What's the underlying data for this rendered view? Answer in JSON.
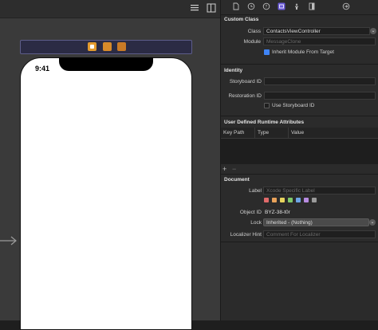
{
  "canvas": {
    "device_time": "9:41",
    "top_icons": [
      "list-icon",
      "split-view-icon"
    ],
    "scene_icons": [
      "view-controller-icon",
      "first-responder-icon",
      "exit-icon"
    ]
  },
  "inspector": {
    "tab_icons": [
      "file-icon",
      "history-icon",
      "help-icon",
      "identity-icon",
      "attributes-icon",
      "size-icon",
      "connections-icon"
    ],
    "custom_class": {
      "title": "Custom Class",
      "class_label": "Class",
      "class_value": "ContactsViewController",
      "module_label": "Module",
      "module_placeholder": "MessageClone",
      "inherit_label": "Inherit Module From Target",
      "inherit_checked": true
    },
    "identity": {
      "title": "Identity",
      "storyboard_id_label": "Storyboard ID",
      "storyboard_id_value": "",
      "restoration_id_label": "Restoration ID",
      "restoration_id_value": "",
      "use_storyboard_label": "Use Storyboard ID",
      "use_storyboard_checked": false
    },
    "runtime_attributes": {
      "title": "User Defined Runtime Attributes",
      "columns": [
        "Key Path",
        "Type",
        "Value"
      ],
      "add_label": "+",
      "remove_label": "−"
    },
    "document": {
      "title": "Document",
      "label_label": "Label",
      "label_placeholder": "Xcode Specific Label",
      "swatch_colors": [
        "#e06a6a",
        "#e9a25a",
        "#e6d35e",
        "#7fc96b",
        "#6da4e6",
        "#b78be0",
        "#9a9a9a"
      ],
      "object_id_label": "Object ID",
      "object_id_value": "BYZ-38-t0r",
      "lock_label": "Lock",
      "lock_value": "Inherited - (Nothing)",
      "localizer_label": "Localizer Hint",
      "localizer_placeholder": "Comment For Localizer"
    }
  }
}
